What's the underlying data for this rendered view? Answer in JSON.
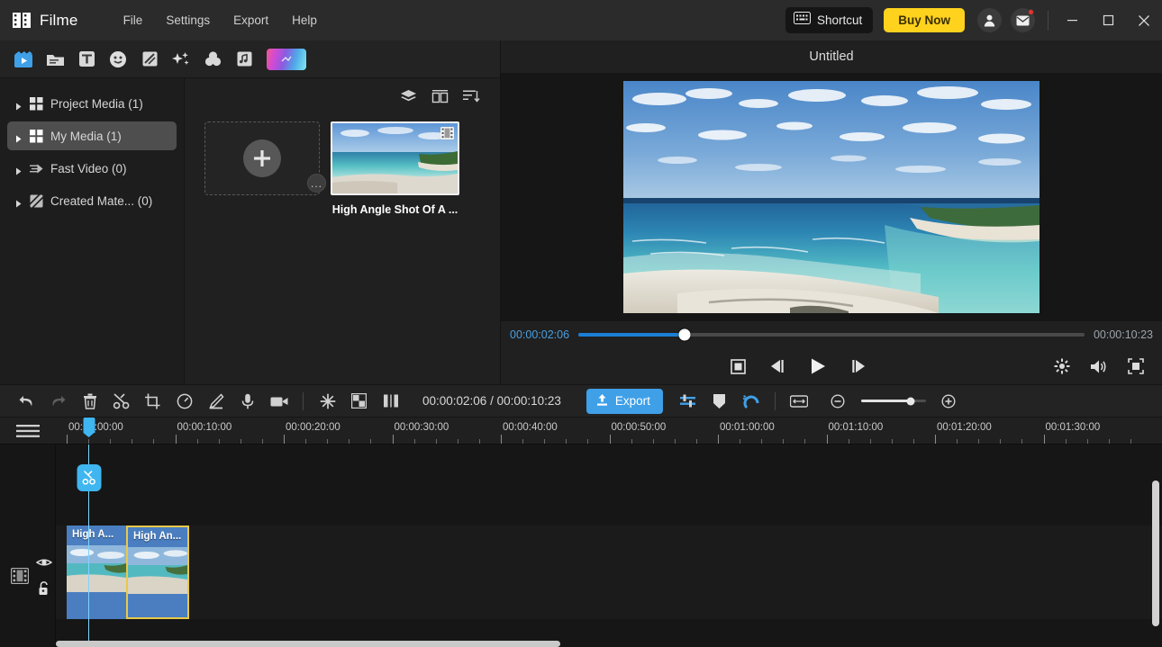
{
  "titlebar": {
    "brand": "Filme",
    "menus": [
      "File",
      "Settings",
      "Export",
      "Help"
    ],
    "shortcut_label": "Shortcut",
    "buy_label": "Buy Now",
    "account_icon": "account-icon",
    "mail_icon": "mail-icon",
    "minimize_icon": "minimize-icon",
    "maximize_icon": "maximize-icon",
    "close_icon": "close-icon"
  },
  "tooltabs": [
    {
      "name": "media-tab",
      "icon": "clapperboard-icon",
      "active": true
    },
    {
      "name": "template-tab",
      "icon": "folder-icon",
      "active": false
    },
    {
      "name": "text-tab",
      "icon": "text-icon",
      "active": false
    },
    {
      "name": "sticker-tab",
      "icon": "smiley-icon",
      "active": false
    },
    {
      "name": "transition-tab",
      "icon": "transition-icon",
      "active": false
    },
    {
      "name": "effects-tab",
      "icon": "sparkle-icon",
      "active": false
    },
    {
      "name": "filter-tab",
      "icon": "color-circles-icon",
      "active": false
    },
    {
      "name": "audio-tab",
      "icon": "music-note-icon",
      "active": false
    },
    {
      "name": "gradient-tab",
      "icon": "gradient-icon",
      "active": false
    }
  ],
  "sidebar": {
    "items": [
      {
        "label": "Project Media (1)",
        "icon": "grid-icon",
        "selected": false
      },
      {
        "label": "My Media (1)",
        "icon": "grid-icon",
        "selected": true
      },
      {
        "label": "Fast Video (0)",
        "icon": "fast-video-icon",
        "selected": false
      },
      {
        "label": "Created Mate... (0)",
        "icon": "created-material-icon",
        "selected": false
      }
    ]
  },
  "media_panel": {
    "tools": [
      {
        "name": "layers-view-icon"
      },
      {
        "name": "grid-view-icon"
      },
      {
        "name": "sort-icon"
      }
    ],
    "import_label": "+",
    "more_label": "...",
    "items": [
      {
        "caption": "High Angle Shot Of A ...",
        "badge": "film-icon"
      }
    ]
  },
  "preview": {
    "title": "Untitled",
    "current_time": "00:00:02:06",
    "total_time": "00:00:10:23",
    "progress_percent": 21,
    "controls": [
      {
        "name": "stop-button",
        "icon": "stop-icon"
      },
      {
        "name": "previous-frame-button",
        "icon": "previous-frame-icon"
      },
      {
        "name": "play-button",
        "icon": "play-icon"
      },
      {
        "name": "next-frame-button",
        "icon": "next-frame-icon"
      }
    ],
    "right_controls": [
      {
        "name": "snapshot-button",
        "icon": "gear-snapshot-icon"
      },
      {
        "name": "volume-button",
        "icon": "speaker-icon"
      },
      {
        "name": "fullscreen-button",
        "icon": "fullscreen-icon"
      }
    ]
  },
  "timeline_toolbar": {
    "tools": [
      {
        "name": "undo-button",
        "icon": "undo-icon",
        "disabled": false
      },
      {
        "name": "redo-button",
        "icon": "redo-icon",
        "disabled": true
      },
      {
        "name": "delete-button",
        "icon": "trash-icon",
        "disabled": false
      },
      {
        "name": "split-button",
        "icon": "scissors-icon",
        "disabled": false
      },
      {
        "name": "crop-button",
        "icon": "crop-icon",
        "disabled": false
      },
      {
        "name": "speed-button",
        "icon": "speedometer-icon",
        "disabled": false
      },
      {
        "name": "color-edit-button",
        "icon": "pen-icon",
        "disabled": false
      },
      {
        "name": "voiceover-button",
        "icon": "microphone-icon",
        "disabled": false
      },
      {
        "name": "record-button",
        "icon": "camcorder-icon",
        "disabled": false
      }
    ],
    "tools2": [
      {
        "name": "freeze-frame-button",
        "icon": "sparkle-star-icon"
      },
      {
        "name": "green-screen-button",
        "icon": "checkerboard-icon"
      },
      {
        "name": "mirror-button",
        "icon": "mirror-icon"
      }
    ],
    "time_display": "00:00:02:06 / 00:00:10:23",
    "export_label": "Export",
    "right_tools": [
      {
        "name": "align-button",
        "icon": "align-icon",
        "active": true
      },
      {
        "name": "marker-button",
        "icon": "marker-icon",
        "active": false
      },
      {
        "name": "snap-button",
        "icon": "magnet-icon",
        "active": true
      }
    ],
    "fit_icon": "fit-to-screen-icon",
    "zoom_out_icon": "zoom-out-icon",
    "zoom_in_icon": "zoom-in-icon",
    "zoom_percent": 76
  },
  "timeline": {
    "menu_icon": "timeline-menu-icon",
    "ruler_labels": [
      "00:00:00:00",
      "00:00:10:00",
      "00:00:20:00",
      "00:00:30:00",
      "00:00:40:00",
      "00:00:50:00",
      "00:01:00:00",
      "00:01:10:00",
      "00:01:20:00",
      "00:01:30:00"
    ],
    "playhead_time": "00:00:02:06",
    "split_icon": "scissors-icon",
    "track": {
      "video_icon": "film-track-icon",
      "eye_icon": "eye-icon",
      "lock_icon": "unlock-icon"
    },
    "clips": [
      {
        "label": "High A...",
        "selected": false
      },
      {
        "label": "High An...",
        "selected": true
      }
    ]
  },
  "colors": {
    "accent_blue": "#3fa0e8",
    "buy_yellow": "#ffd21e",
    "clip_blue": "#4a7ec0",
    "selection_yellow": "#e8c84a",
    "playhead_blue": "#3fb6f0"
  }
}
